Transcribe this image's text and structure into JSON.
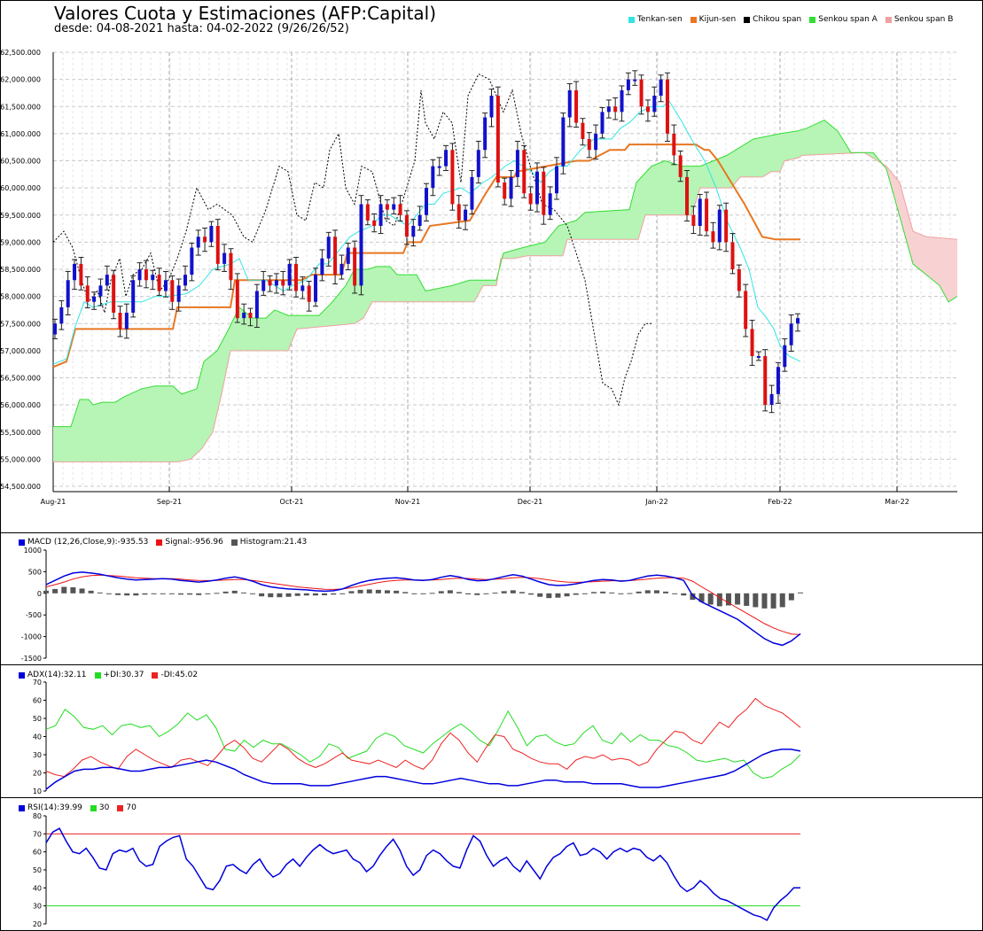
{
  "header": {
    "title": "Valores Cuota y Estimaciones (AFP:Capital)",
    "subtitle": "desde: 04-08-2021 hasta: 04-02-2022 (9/26/26/52)"
  },
  "colors": {
    "tenkan": "#33e5e5",
    "kijun": "#e87722",
    "chikou": "#000000",
    "span_a": "#33dd33",
    "span_b": "#f0a0a0",
    "cloud_bull": "#b6f5b6",
    "cloud_bear": "#f8d2d2",
    "candle_up": "#1111cc",
    "candle_down": "#dd1111",
    "macd": "#0000dd",
    "signal": "#ee1111",
    "histogram": "#555555",
    "adx": "#0000dd",
    "plus_di": "#22dd22",
    "minus_di": "#ee2222",
    "rsi": "#0000dd",
    "rsi30": "#22dd22",
    "rsi70": "#ee2222"
  },
  "chart_data": [
    {
      "type": "candlestick",
      "name": "main",
      "legend": [
        "Tenkan-sen",
        "Kijun-sen",
        "Chikou span",
        "Senkou span A",
        "Senkou span B"
      ],
      "y_ticks": [
        "$54,500.000",
        "$55,000.000",
        "$55,500.000",
        "$56,000.000",
        "$56,500.000",
        "$57,000.000",
        "$57,500.000",
        "$58,000.000",
        "$58,500.000",
        "$59,000.000",
        "$59,500.000",
        "$60,000.000",
        "$60,500.000",
        "$61,000.000",
        "$61,500.000",
        "$62,000.000",
        "$62,500.000"
      ],
      "ylim": [
        54500,
        62500
      ],
      "x_ticks": [
        "Aug-21",
        "Sep-21",
        "Oct-21",
        "Nov-21",
        "Dec-21",
        "Jan-22",
        "Feb-22",
        "Mar-22"
      ],
      "grid": true,
      "candles_close": [
        57500,
        57800,
        58300,
        58600,
        58200,
        57900,
        58000,
        58200,
        58400,
        57700,
        57400,
        57700,
        58300,
        58500,
        58300,
        58400,
        58100,
        58300,
        57900,
        58200,
        58400,
        58900,
        59100,
        59000,
        59300,
        58600,
        58800,
        58300,
        57600,
        57700,
        57600,
        58100,
        58300,
        58200,
        58300,
        58200,
        58600,
        58100,
        58200,
        57900,
        58400,
        58700,
        59100,
        58400,
        58600,
        58900,
        58200,
        59700,
        59400,
        59300,
        59700,
        59600,
        59700,
        59500,
        59100,
        59300,
        59500,
        60000,
        60400,
        60400,
        60700,
        59700,
        59400,
        59600,
        60200,
        60700,
        61300,
        61700,
        60100,
        59800,
        60200,
        60700,
        59900,
        59700,
        60300,
        59500,
        59900,
        60400,
        61300,
        61800,
        61200,
        60900,
        60700,
        61000,
        61400,
        61500,
        61400,
        61800,
        62000,
        62000,
        61500,
        61400,
        61700,
        62000,
        61000,
        60600,
        60200,
        59500,
        59300,
        59800,
        59200,
        59000,
        59600,
        59000,
        58500,
        58100,
        57400,
        56900,
        56900,
        56000,
        56200,
        56700,
        57100,
        57500,
        57600
      ]
    },
    {
      "type": "line",
      "name": "macd",
      "legend": [
        "MACD (12,26,Close,9):-935.53",
        "Signal:-956.96",
        "Histogram:21.43"
      ],
      "y_ticks": [
        "1000",
        "500",
        "0",
        "-500",
        "-1000",
        "-1500"
      ],
      "ylim": [
        -1500,
        1000
      ],
      "series": [
        {
          "name": "MACD (12,26,Close,9)",
          "values": [
            200,
            300,
            400,
            470,
            490,
            470,
            440,
            400,
            360,
            330,
            310,
            320,
            330,
            340,
            330,
            300,
            280,
            260,
            280,
            310,
            350,
            380,
            340,
            280,
            200,
            150,
            120,
            100,
            90,
            80,
            60,
            50,
            60,
            100,
            180,
            250,
            300,
            330,
            350,
            360,
            340,
            310,
            300,
            320,
            370,
            410,
            380,
            320,
            290,
            300,
            340,
            390,
            430,
            400,
            330,
            260,
            200,
            180,
            190,
            220,
            260,
            300,
            320,
            310,
            280,
            300,
            350,
            400,
            420,
            400,
            360,
            300,
            -50,
            -200,
            -300,
            -400,
            -500,
            -600,
            -750,
            -900,
            -1050,
            -1150,
            -1200,
            -1100,
            -935
          ]
        },
        {
          "name": "Signal",
          "values": [
            150,
            200,
            260,
            330,
            380,
            410,
            420,
            410,
            400,
            380,
            360,
            350,
            340,
            340,
            340,
            330,
            310,
            300,
            295,
            300,
            310,
            320,
            320,
            300,
            270,
            240,
            210,
            180,
            150,
            130,
            110,
            95,
            90,
            100,
            130,
            170,
            210,
            250,
            280,
            300,
            310,
            310,
            305,
            310,
            320,
            340,
            350,
            345,
            330,
            320,
            325,
            340,
            360,
            370,
            360,
            340,
            310,
            280,
            260,
            255,
            260,
            270,
            280,
            290,
            290,
            295,
            310,
            330,
            350,
            360,
            360,
            350,
            280,
            150,
            30,
            -100,
            -220,
            -340,
            -460,
            -580,
            -700,
            -800,
            -880,
            -940,
            -957
          ]
        },
        {
          "name": "Histogram",
          "values": [
            60,
            100,
            150,
            140,
            110,
            60,
            20,
            -10,
            -40,
            -50,
            -50,
            -30,
            -10,
            0,
            -10,
            -30,
            -30,
            -40,
            -15,
            10,
            40,
            60,
            20,
            -20,
            -70,
            -90,
            -90,
            -80,
            -60,
            -50,
            -50,
            -45,
            -30,
            0,
            50,
            80,
            90,
            80,
            70,
            60,
            30,
            0,
            -5,
            10,
            50,
            70,
            30,
            -25,
            -40,
            -20,
            15,
            50,
            70,
            30,
            -30,
            -80,
            -110,
            -100,
            -70,
            -35,
            0,
            30,
            40,
            20,
            -10,
            5,
            40,
            70,
            70,
            40,
            0,
            -50,
            -150,
            -200,
            -260,
            -300,
            -280,
            -260,
            -290,
            -320,
            -350,
            -350,
            -320,
            -160,
            21
          ]
        }
      ]
    },
    {
      "type": "line",
      "name": "adx",
      "legend": [
        "ADX(14):32.11",
        "+DI:30.37",
        "-DI:45.02"
      ],
      "y_ticks": [
        "70",
        "60",
        "50",
        "40",
        "30",
        "20",
        "10"
      ],
      "ylim": [
        10,
        70
      ],
      "series": [
        {
          "name": "ADX(14)",
          "values": [
            11,
            15,
            18,
            21,
            22,
            22,
            23,
            23,
            22,
            21,
            21,
            22,
            23,
            23,
            24,
            25,
            26,
            27,
            26,
            24,
            22,
            19,
            17,
            15,
            14,
            14,
            14,
            14,
            13,
            13,
            13,
            14,
            15,
            16,
            17,
            18,
            18,
            17,
            16,
            15,
            14,
            14,
            15,
            16,
            17,
            16,
            15,
            14,
            14,
            13,
            13,
            14,
            15,
            16,
            16,
            15,
            15,
            15,
            14,
            14,
            14,
            14,
            13,
            12,
            12,
            12,
            13,
            14,
            15,
            16,
            17,
            18,
            19,
            21,
            24,
            27,
            30,
            32,
            33,
            33,
            32
          ]
        },
        {
          "name": "+DI",
          "values": [
            44,
            46,
            55,
            51,
            45,
            44,
            46,
            41,
            46,
            47,
            45,
            46,
            40,
            43,
            47,
            53,
            49,
            52,
            45,
            33,
            32,
            38,
            34,
            38,
            36,
            36,
            33,
            30,
            26,
            29,
            36,
            34,
            28,
            30,
            32,
            39,
            42,
            40,
            35,
            33,
            31,
            36,
            40,
            44,
            47,
            43,
            38,
            35,
            44,
            54,
            45,
            35,
            40,
            41,
            37,
            35,
            36,
            42,
            46,
            38,
            36,
            42,
            37,
            41,
            38,
            38,
            35,
            34,
            31,
            27,
            26,
            27,
            28,
            26,
            27,
            20,
            17,
            18,
            22,
            25,
            30
          ]
        },
        {
          "name": "-DI",
          "values": [
            21,
            19,
            18,
            22,
            27,
            29,
            26,
            24,
            22,
            29,
            33,
            30,
            27,
            25,
            23,
            27,
            28,
            26,
            24,
            29,
            35,
            38,
            34,
            28,
            26,
            31,
            36,
            33,
            28,
            25,
            23,
            25,
            28,
            31,
            27,
            26,
            25,
            27,
            25,
            23,
            27,
            24,
            22,
            27,
            36,
            42,
            38,
            31,
            26,
            34,
            41,
            40,
            33,
            31,
            28,
            26,
            25,
            25,
            22,
            27,
            29,
            28,
            30,
            27,
            28,
            27,
            24,
            26,
            33,
            38,
            43,
            42,
            38,
            36,
            42,
            48,
            45,
            51,
            55,
            61,
            57,
            55,
            53,
            49,
            45
          ]
        }
      ]
    },
    {
      "type": "line",
      "name": "rsi",
      "legend": [
        "RSI(14):39.99",
        "30",
        "70"
      ],
      "y_ticks": [
        "80",
        "70",
        "60",
        "50",
        "40",
        "30",
        "20"
      ],
      "ylim": [
        20,
        80
      ],
      "series": [
        {
          "name": "RSI(14)",
          "values": [
            65,
            71,
            73,
            66,
            60,
            59,
            62,
            57,
            51,
            50,
            59,
            61,
            60,
            62,
            55,
            52,
            53,
            63,
            66,
            68,
            69,
            56,
            52,
            46,
            40,
            39,
            44,
            52,
            53,
            50,
            48,
            53,
            56,
            50,
            46,
            48,
            53,
            56,
            52,
            57,
            61,
            64,
            61,
            59,
            60,
            61,
            56,
            54,
            49,
            52,
            58,
            63,
            67,
            61,
            52,
            47,
            50,
            58,
            61,
            59,
            55,
            52,
            51,
            61,
            69,
            66,
            58,
            52,
            55,
            57,
            52,
            49,
            55,
            50,
            45,
            52,
            57,
            59,
            63,
            65,
            58,
            59,
            62,
            60,
            56,
            60,
            62,
            60,
            62,
            61,
            57,
            55,
            58,
            54,
            47,
            41,
            38,
            40,
            44,
            41,
            37,
            34,
            33,
            31,
            29,
            27,
            25,
            24,
            22,
            29,
            33,
            36,
            40,
            40
          ]
        },
        {
          "name": "30",
          "values": [
            30,
            30
          ]
        },
        {
          "name": "70",
          "values": [
            70,
            70
          ]
        }
      ]
    }
  ]
}
